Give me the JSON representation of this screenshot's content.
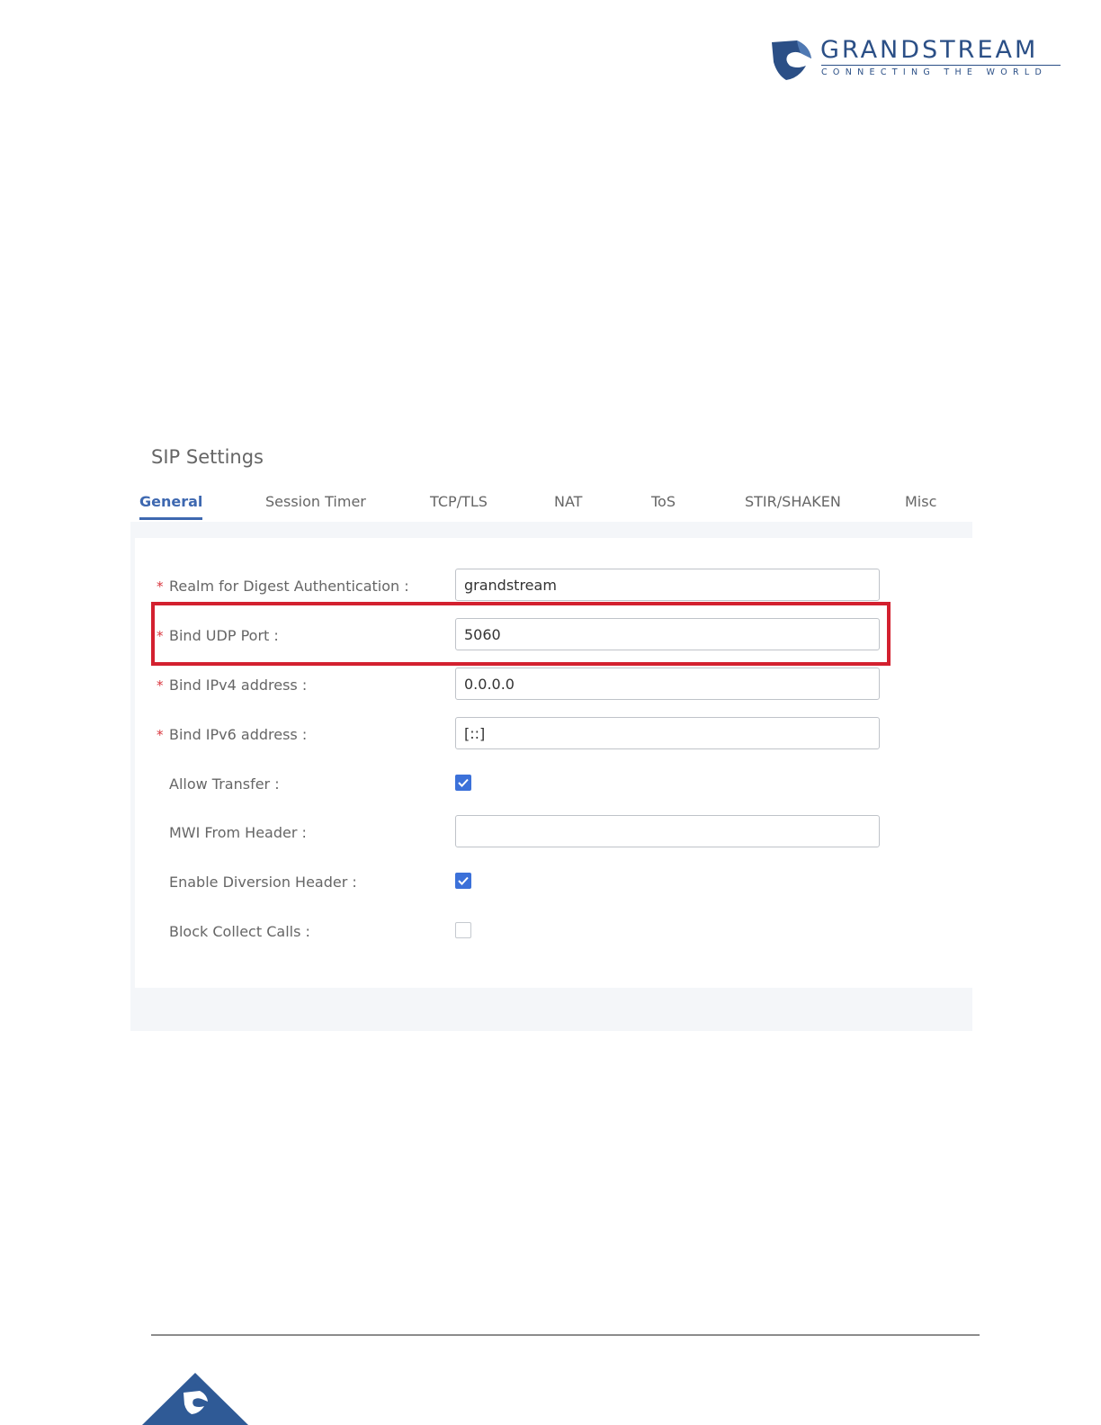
{
  "logo": {
    "brand": "GRANDSTREAM",
    "tagline": "CONNECTING THE WORLD"
  },
  "section_title": "SIP Settings",
  "tabs": [
    {
      "label": "General",
      "active": true
    },
    {
      "label": "Session Timer",
      "active": false
    },
    {
      "label": "TCP/TLS",
      "active": false
    },
    {
      "label": "NAT",
      "active": false
    },
    {
      "label": "ToS",
      "active": false
    },
    {
      "label": "STIR/SHAKEN",
      "active": false
    },
    {
      "label": "Misc",
      "active": false
    }
  ],
  "fields": {
    "realm": {
      "label": "Realm for Digest Authentication :",
      "value": "grandstream",
      "required": true
    },
    "bind_udp_port": {
      "label": "Bind UDP Port :",
      "value": "5060",
      "required": true
    },
    "bind_ipv4": {
      "label": "Bind IPv4 address :",
      "value": "0.0.0.0",
      "required": true
    },
    "bind_ipv6": {
      "label": "Bind IPv6 address :",
      "value": "[::]",
      "required": true
    },
    "allow_transfer": {
      "label": "Allow Transfer :",
      "checked": true
    },
    "mwi_from_header": {
      "label": "MWI From Header :",
      "value": ""
    },
    "enable_diversion_header": {
      "label": "Enable Diversion Header :",
      "checked": true
    },
    "block_collect_calls": {
      "label": "Block Collect Calls :",
      "checked": false
    }
  },
  "required_marker": "*",
  "colors": {
    "brand_blue": "#2b4f86",
    "tab_active": "#3e68b0",
    "highlight_red": "#d3202f",
    "checkbox_checked": "#3c71d9"
  }
}
